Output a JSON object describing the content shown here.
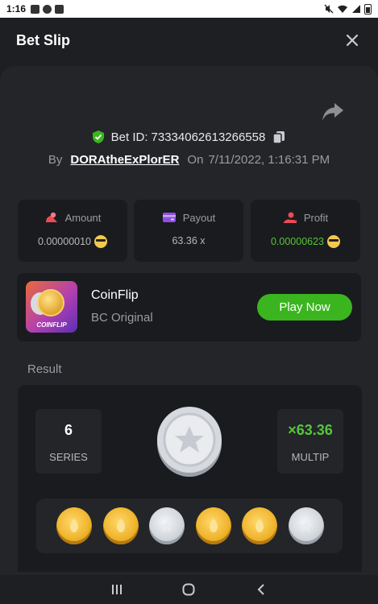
{
  "status_bar": {
    "time": "1:16"
  },
  "header": {
    "title": "Bet Slip"
  },
  "bet": {
    "id_label": "Bet ID:",
    "id": "73334062613266558",
    "by_label": "By",
    "user": "DORAtheExPlorER",
    "on_label": "On",
    "datetime": "7/11/2022, 1:16:31 PM"
  },
  "stats": {
    "amount": {
      "label": "Amount",
      "value": "0.00000010"
    },
    "payout": {
      "label": "Payout",
      "value": "63.36 x"
    },
    "profit": {
      "label": "Profit",
      "value": "0.00000623"
    }
  },
  "game": {
    "thumb_label": "COINFLIP",
    "name": "CoinFlip",
    "subtitle": "BC Original",
    "play_label": "Play Now"
  },
  "result": {
    "title": "Result",
    "series_value": "6",
    "series_label": "SERIES",
    "multip_value": "×63.36",
    "multip_label": "MULTIP",
    "coins": [
      "gold",
      "gold",
      "silver",
      "gold",
      "gold",
      "silver"
    ]
  },
  "colors": {
    "accent_green": "#3bb51f",
    "profit_green": "#55c738",
    "background": "#1e1f22",
    "card": "#1a1b1e"
  },
  "icons": {
    "shield": "shield-check-icon",
    "copy": "copy-icon",
    "share": "share-icon",
    "close": "close-icon",
    "amount": "amount-icon",
    "payout": "wallet-icon",
    "profit": "profit-hand-icon"
  }
}
